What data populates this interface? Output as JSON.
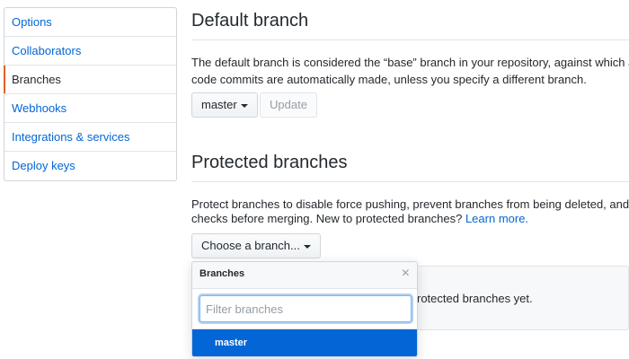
{
  "sidebar": {
    "items": [
      {
        "label": "Options"
      },
      {
        "label": "Collaborators"
      },
      {
        "label": "Branches"
      },
      {
        "label": "Webhooks"
      },
      {
        "label": "Integrations & services"
      },
      {
        "label": "Deploy keys"
      }
    ],
    "selected_index": 2
  },
  "default_branch": {
    "title": "Default branch",
    "description_line1": "The default branch is considered the “base” branch in your repository, against which all",
    "description_line2": "code commits are automatically made, unless you specify a different branch.",
    "branch_select_label": "master",
    "update_button_label": "Update"
  },
  "protected_branches": {
    "title": "Protected branches",
    "description_line1": "Protect branches to disable force pushing, prevent branches from being deleted, and op",
    "description_line2_prefix": "checks before merging. New to protected branches? ",
    "learn_more_label": "Learn more.",
    "choose_branch_label": "Choose a branch...",
    "empty_text": "rotected branches yet."
  },
  "dropdown": {
    "header": "Branches",
    "close_glyph": "×",
    "filter_placeholder": "Filter branches",
    "filter_value": "",
    "items": [
      {
        "label": "master"
      }
    ]
  },
  "colors": {
    "link": "#0366d6",
    "selected_accent": "#e36209",
    "highlight": "#0366d6"
  }
}
